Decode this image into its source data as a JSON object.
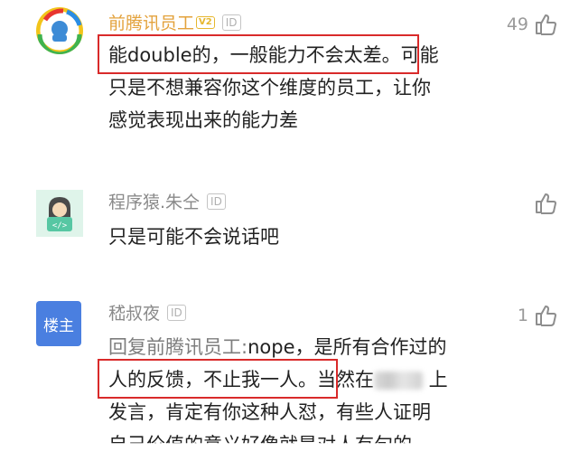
{
  "comments": [
    {
      "username": "前腾讯员工",
      "vip_badge": "V2",
      "id_badge": "ID",
      "likes": "49",
      "lines": [
        "能double的，一般能力不会太差。可能",
        "只是不想兼容你这个维度的员工，让你",
        "感觉表现出来的能力差"
      ]
    },
    {
      "username": "程序猿.朱仝",
      "id_badge": "ID",
      "likes": "",
      "avatar_text": "</>",
      "lines": [
        "只是可能不会说话吧"
      ]
    },
    {
      "username": "嵇叔夜",
      "id_badge": "ID",
      "likes": "1",
      "avatar_text": "楼主",
      "reply_prefix": "回复前腾讯员工:",
      "lines": [
        "nope，是所有合作过的",
        "人的反馈，不止我一人。当然在",
        "发言，肯定有你这种人怼，有些人证明",
        "自己价值的意义好像就是对人有句的"
      ],
      "blurred_after": "当然在"
    }
  ],
  "colors": {
    "username_vip": "#e3a23c",
    "username_normal": "#8a8a8a",
    "text": "#222222",
    "highlight": "#d92a2a",
    "op_badge": "#4a7fe0"
  }
}
